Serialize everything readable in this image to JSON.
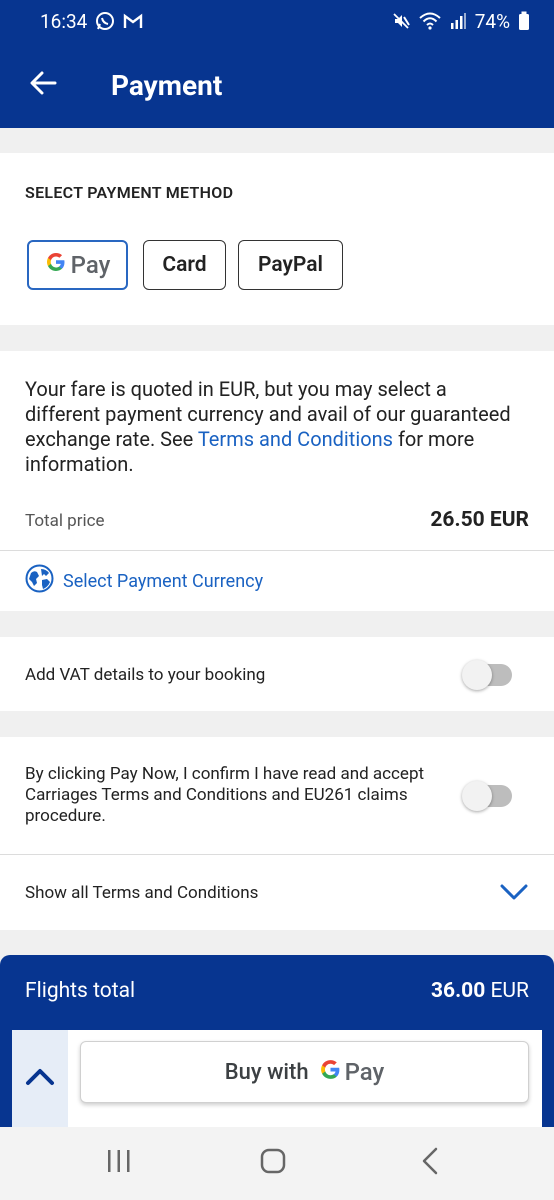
{
  "status_bar": {
    "time": "16:34",
    "battery": "74%",
    "icons": [
      "whatsapp-icon",
      "gmail-icon",
      "mute-icon",
      "wifi-icon",
      "signal-icon",
      "battery-icon"
    ]
  },
  "app_bar": {
    "title": "Payment",
    "back_icon": "back-arrow-icon"
  },
  "payment_method": {
    "heading": "SELECT PAYMENT METHOD",
    "options": [
      {
        "label": "Pay",
        "brand": "G",
        "selected": true
      },
      {
        "label": "Card",
        "selected": false
      },
      {
        "label": "PayPal",
        "selected": false
      }
    ]
  },
  "fare": {
    "text_before": "Your fare is quoted in EUR, but you may select a different payment currency and avail of our guaranteed exchange rate. See ",
    "link": "Terms and Conditions",
    "text_after": " for more information.",
    "total_label": "Total price",
    "total_value": "26.50 EUR",
    "currency_link": "Select Payment Currency"
  },
  "vat": {
    "label": "Add VAT details to your booking",
    "enabled": false
  },
  "consent": {
    "label": "By clicking Pay Now, I confirm I have read and accept Carriages Terms and Conditions and EU261 claims procedure.",
    "enabled": false,
    "show_all": "Show all Terms and Conditions"
  },
  "footer": {
    "label": "Flights total",
    "amount": "36.00",
    "currency": "EUR",
    "buy_prefix": "Buy with",
    "buy_brand_g": "G",
    "buy_brand_pay": "Pay"
  },
  "colors": {
    "primary": "#073590",
    "link": "#1a62c2",
    "selected_border": "#2967c1"
  }
}
